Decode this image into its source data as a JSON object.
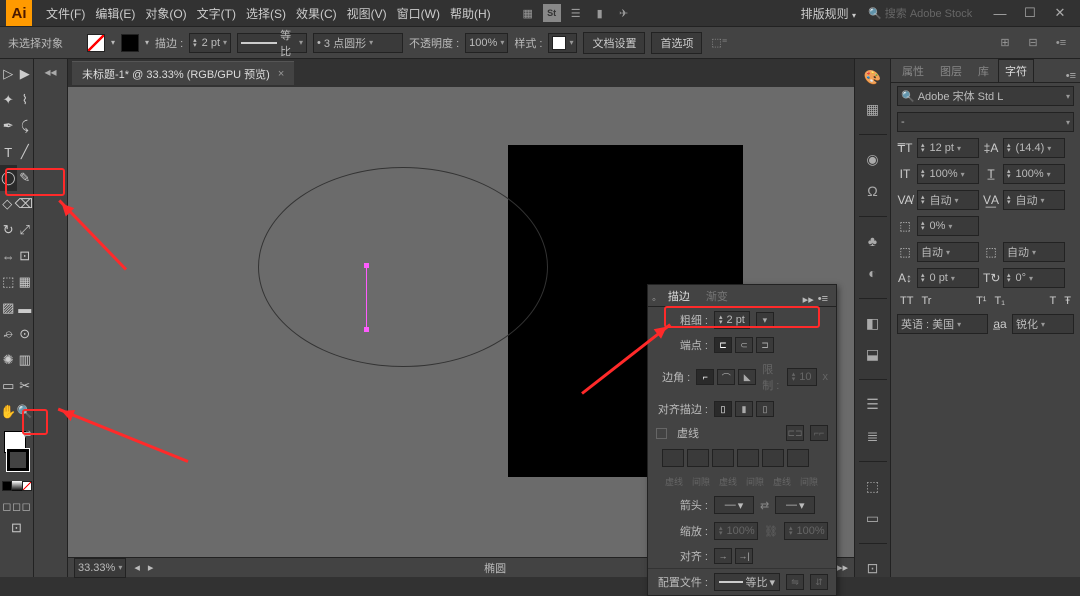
{
  "app": {
    "name": "Ai"
  },
  "menu": {
    "file": "文件(F)",
    "edit": "编辑(E)",
    "object": "对象(O)",
    "type": "文字(T)",
    "select": "选择(S)",
    "effect": "效果(C)",
    "view": "视图(V)",
    "window": "窗口(W)",
    "help": "帮助(H)"
  },
  "layout_preset": "排版规则",
  "search_ph": "搜索 Adobe Stock",
  "optbar": {
    "noSelection": "未选择对象",
    "stroke_lbl": "描边 :",
    "stroke_w": "2 pt",
    "uniform": "等比",
    "dash": "3 点圆形",
    "opacity_lbl": "不透明度 :",
    "opacity": "100%",
    "style_lbl": "样式 :",
    "docsetup": "文档设置",
    "prefs": "首选项"
  },
  "doc": {
    "tab": "未标题-1* @ 33.33% (RGB/GPU 预览)"
  },
  "status": {
    "zoom": "33.33%",
    "tool": "椭圆"
  },
  "stroke_panel": {
    "tabs": {
      "stroke": "描边",
      "grad": "渐变"
    },
    "weight_lbl": "粗细 :",
    "weight": "2 pt",
    "cap_lbl": "端点 :",
    "corner_lbl": "边角 :",
    "limit_lbl": "限制 :",
    "limit": "10",
    "x": "x",
    "align_lbl": "对齐描边 :",
    "dash_chk": "虚线",
    "d1": "虚线",
    "g1": "间隙",
    "d2": "虚线",
    "g2": "间隙",
    "d3": "虚线",
    "g3": "间隙",
    "arrow_lbl": "箭头 :",
    "scale_lbl": "缩放 :",
    "scale1": "100%",
    "scale2": "100%",
    "align2_lbl": "对齐 :",
    "profile_lbl": "配置文件 :",
    "profile": "等比"
  },
  "char": {
    "tabs": {
      "props": "属性",
      "layers": "图层",
      "libs": "库",
      "char": "字符"
    },
    "font": "Adobe 宋体 Std L",
    "style": "-",
    "size_ic": "T",
    "size": "12 pt",
    "leading": "(14.4)",
    "kern": "100%",
    "track": "100%",
    "va": "自动",
    "wa": "自动",
    "baseline": "0%",
    "auto": "自动",
    "shift": "0 pt",
    "rotate": "0°",
    "lang_lbl": "英语 : 美国",
    "aa": "锐化",
    "presets": [
      "TT",
      "Tr",
      "T¹",
      "T₁",
      "T",
      "Ŧ"
    ]
  }
}
